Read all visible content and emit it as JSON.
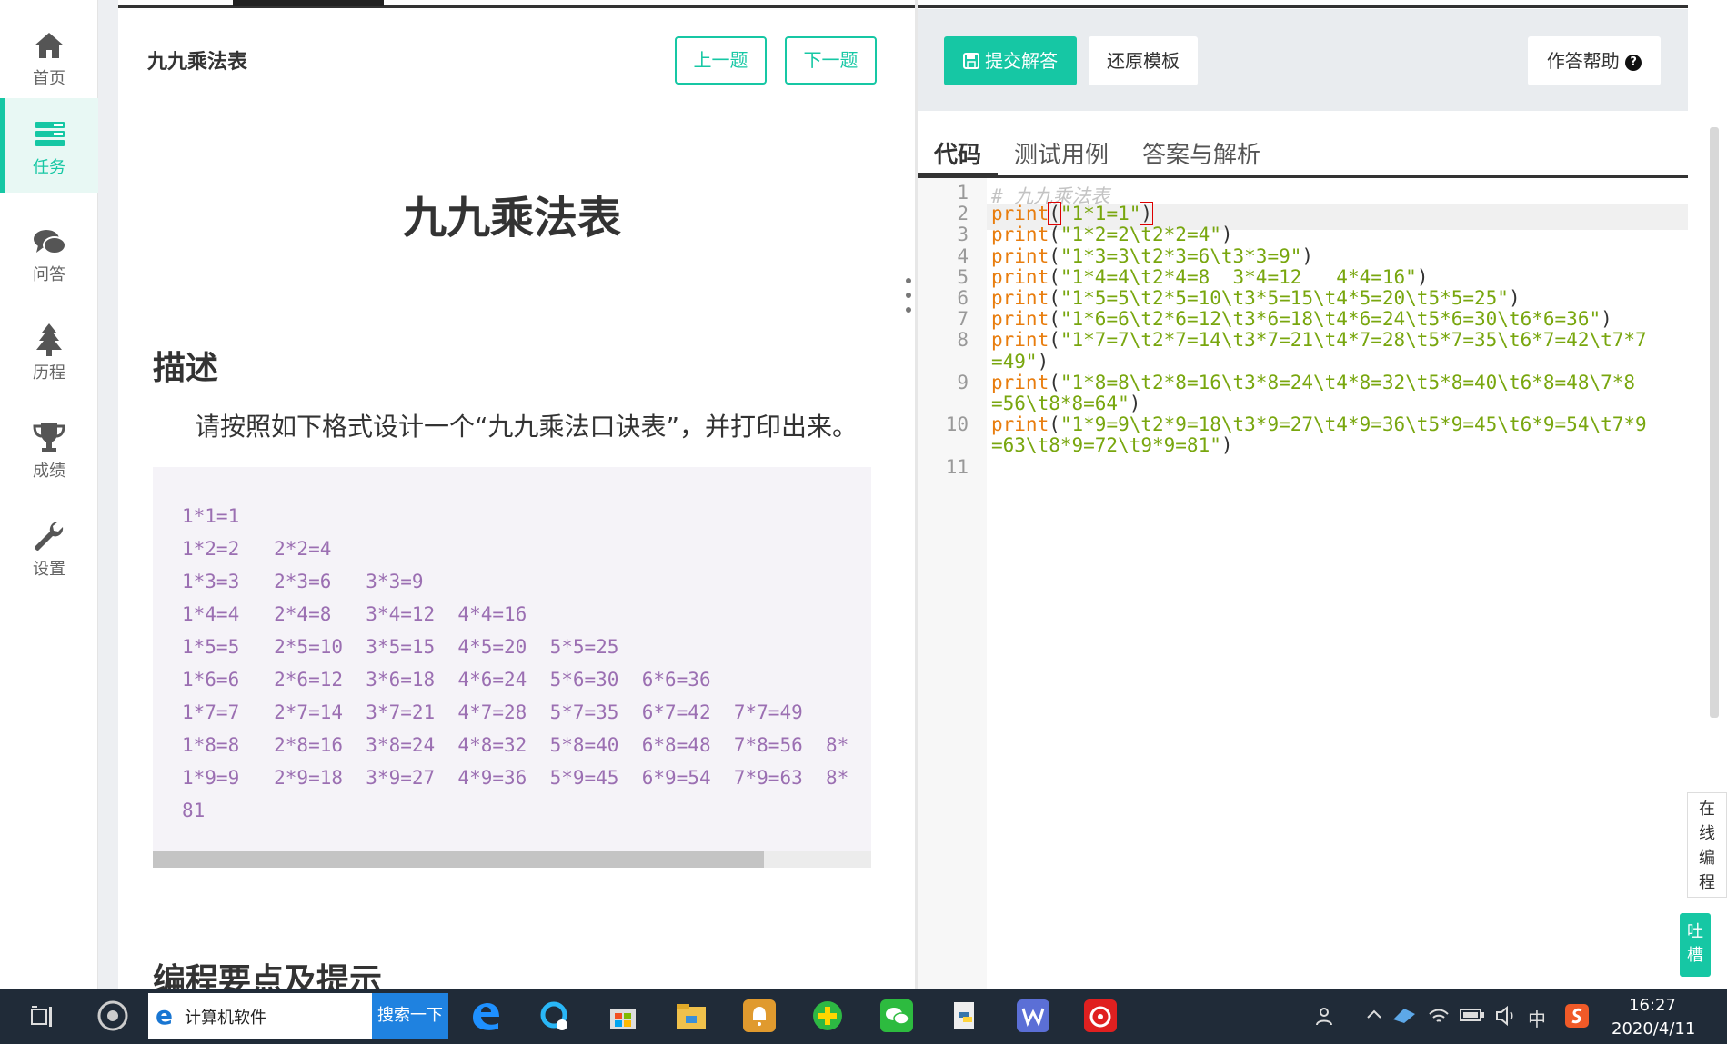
{
  "nav": {
    "items": [
      {
        "label": "首页",
        "icon": "home-icon"
      },
      {
        "label": "任务",
        "icon": "tasks-icon"
      },
      {
        "label": "问答",
        "icon": "chat-icon"
      },
      {
        "label": "历程",
        "icon": "tree-icon"
      },
      {
        "label": "成绩",
        "icon": "trophy-icon"
      },
      {
        "label": "设置",
        "icon": "wrench-icon"
      }
    ],
    "active_index": 1
  },
  "problem": {
    "small_title": "九九乘法表",
    "prev_label": "上一题",
    "next_label": "下一题",
    "big_title": "九九乘法表",
    "desc_heading": "描述",
    "desc_text": "请按照如下格式设计一个“九九乘法口诀表”，并打印出来。",
    "sample_lines": [
      "1*1=1",
      "1*2=2   2*2=4",
      "1*3=3   2*3=6   3*3=9",
      "1*4=4   2*4=8   3*4=12  4*4=16",
      "1*5=5   2*5=10  3*5=15  4*5=20  5*5=25",
      "1*6=6   2*6=12  3*6=18  4*6=24  5*6=30  6*6=36",
      "1*7=7   2*7=14  3*7=21  4*7=28  5*7=35  6*7=42  7*7=49",
      "1*8=8   2*8=16  3*8=24  4*8=32  5*8=40  6*8=48  7*8=56  8*",
      "1*9=9   2*9=18  3*9=27  4*9=36  5*9=45  6*9=54  7*9=63  8*",
      "81"
    ],
    "hint_heading": "编程要点及提示"
  },
  "editor": {
    "submit_label": "提交解答",
    "reset_label": "还原模板",
    "help_label": "作答帮助",
    "help_icon": "?",
    "tabs": [
      "代码",
      "测试用例",
      "答案与解析"
    ],
    "line_numbers": [
      "1",
      "2",
      "3",
      "4",
      "5",
      "6",
      "7",
      "8",
      "9",
      "10",
      "11"
    ],
    "comment": "# 九九乘法表",
    "print_kw": "print",
    "code": [
      "\"1*1=1\"",
      "\"1*2=2\\t2*2=4\"",
      "\"1*3=3\\t2*3=6\\t3*3=9\"",
      "\"1*4=4\\t2*4=8  3*4=12   4*4=16\"",
      "\"1*5=5\\t2*5=10\\t3*5=15\\t4*5=20\\t5*5=25\"",
      "\"1*6=6\\t2*6=12\\t3*6=18\\t4*6=24\\t5*6=30\\t6*6=36\"",
      "\"1*7=7\\t2*7=14\\t3*7=21\\t4*7=28\\t5*7=35\\t6*7=42\\t7*7",
      "=49\"",
      "\"1*8=8\\t2*8=16\\t3*8=24\\t4*8=32\\t5*8=40\\t6*8=48\\7*8",
      "=56\\t8*8=64\"",
      "\"1*9=9\\t2*9=18\\t3*9=27\\t4*9=36\\t5*9=45\\t6*9=54\\t7*9",
      "=63\\t8*9=72\\t9*9=81\""
    ]
  },
  "side": {
    "online_label": "在线编程",
    "feedback_label": "吐槽"
  },
  "taskbar": {
    "search_text": "计算机软件",
    "search_button": "搜索一下",
    "input_method": "中",
    "time": "16:27",
    "date": "2020/4/11"
  },
  "colors": {
    "accent": "#16c7a4",
    "keyword": "#e87d0e",
    "string": "#78a60e",
    "sample_text": "#9b6fb2"
  }
}
